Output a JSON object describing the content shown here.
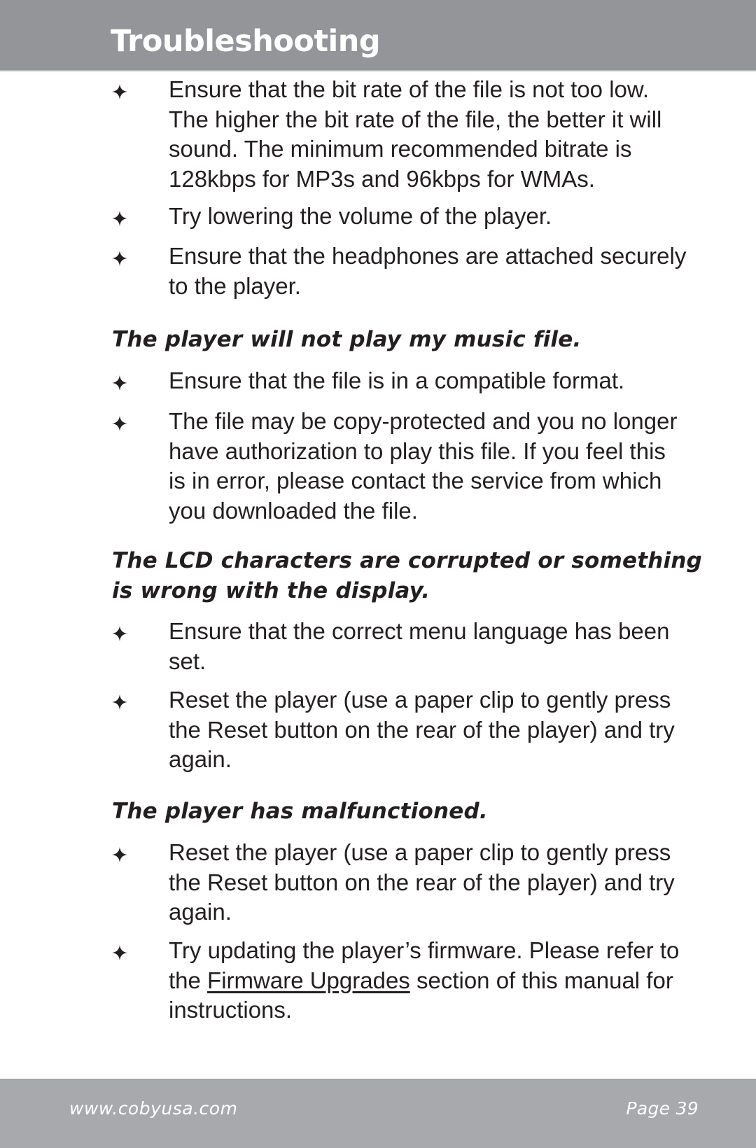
{
  "header": {
    "title": "Troubleshooting"
  },
  "sections": [
    {
      "heading": null,
      "bullets": [
        "Ensure that the bit rate of the file is not too low. The higher the bit rate of the file, the better it will sound. The minimum recommended bitrate is 128kbps for MP3s and 96kbps for WMAs.",
        "Try lowering the volume of the player.",
        "Ensure that the headphones are attached securely to the player."
      ]
    },
    {
      "heading": "The player will not play my music file.",
      "bullets": [
        "Ensure that the file is in a compatible format.",
        "The file may be copy-protected and you no longer have authorization to play this file. If you feel this is in error, please contact the service from which you downloaded the file."
      ]
    },
    {
      "heading": "The LCD characters are corrupted or something is wrong with the display.",
      "bullets": [
        "Ensure that the correct menu language has been set.",
        "Reset the player (use a paper clip to gently press the Reset button on the rear of the player) and try again."
      ]
    },
    {
      "heading": "The player has malfunctioned.",
      "bullets": [
        "Reset the player (use a paper clip to gently press the Reset button on the rear of the player) and try again."
      ],
      "firmware_bullet": {
        "before": "Try updating the player’s firmware. Please refer to the ",
        "link": "Firmware Upgrades",
        "after": " section of this manual for instructions."
      }
    }
  ],
  "bullet_icon": "four-point-star-icon",
  "footer": {
    "url": "www.cobyusa.com",
    "page": "Page 39"
  },
  "colors": {
    "header_bg": "#939598",
    "footer_bg": "#A7A9AC",
    "text": "#231F20"
  }
}
